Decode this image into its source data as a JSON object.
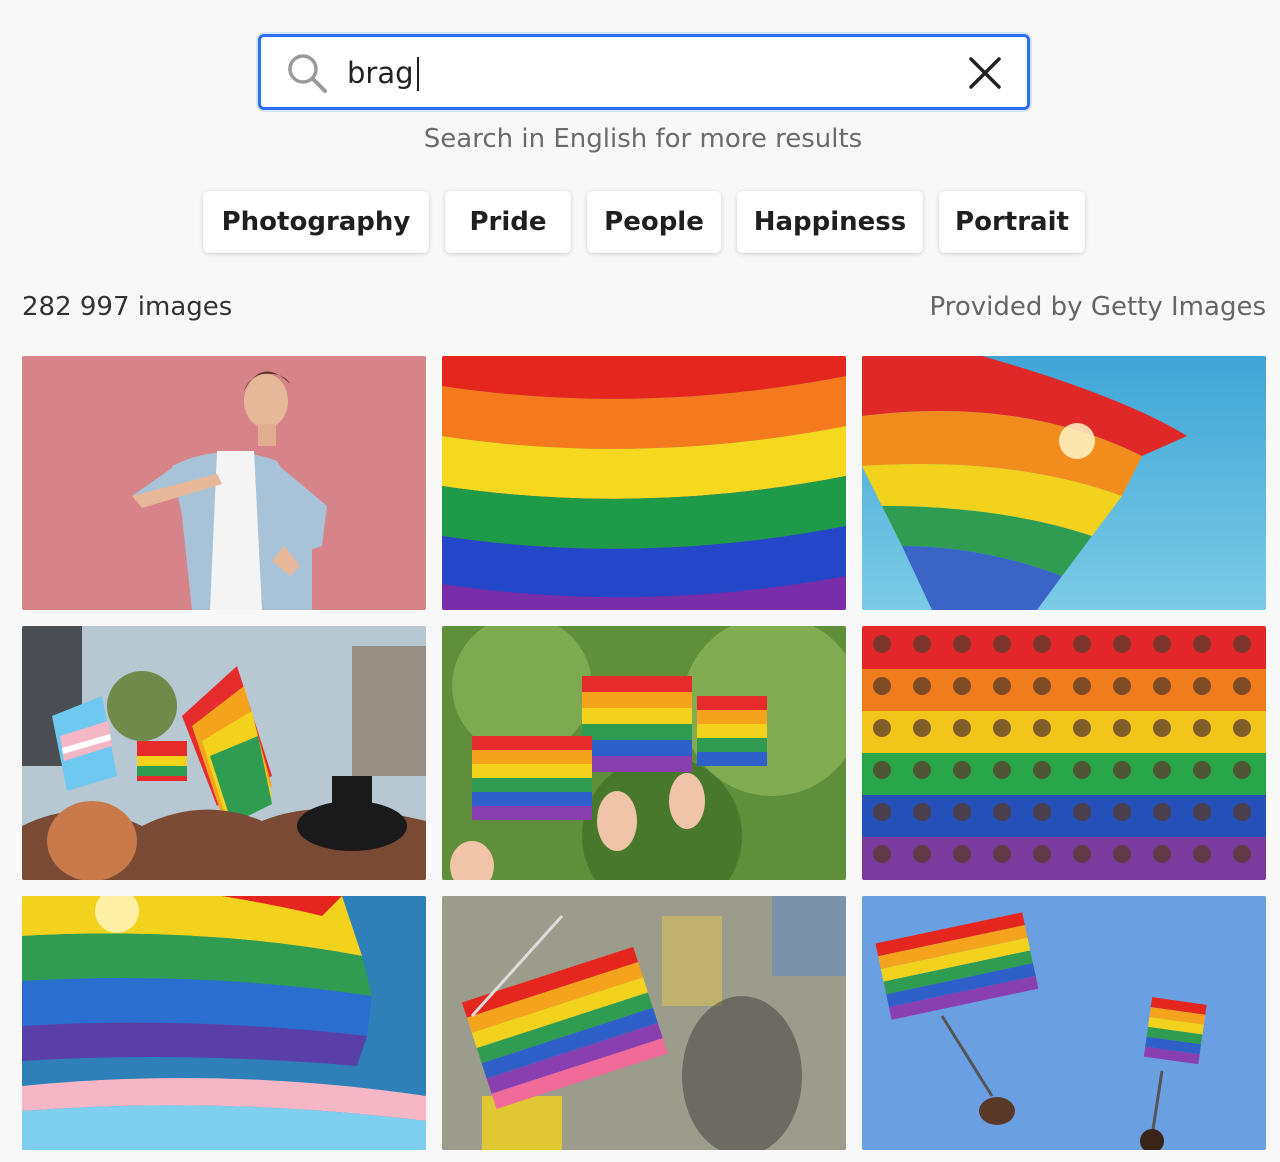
{
  "search": {
    "value": "brag",
    "icon": "search-icon",
    "clear_icon": "close-icon"
  },
  "hint": "Search in English for more results",
  "chips": [
    "Photography",
    "Pride",
    "People",
    "Happiness",
    "Portrait"
  ],
  "results": {
    "count_text": "282 997 images",
    "provider_text": "Provided by Getty Images"
  },
  "colors": {
    "accent": "#2e6ff0",
    "background": "#f8f8f8"
  }
}
